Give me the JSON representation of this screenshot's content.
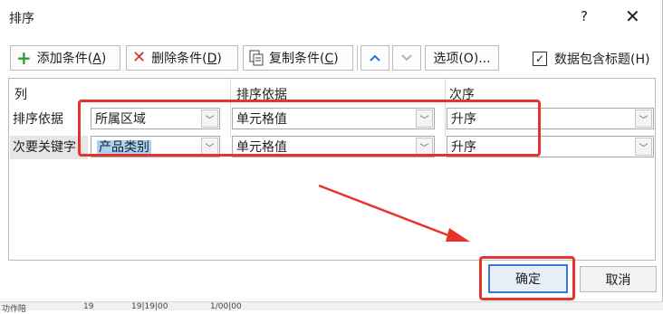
{
  "dialog": {
    "title": "排序",
    "help": "?",
    "close": "✕"
  },
  "toolbar": {
    "add": {
      "text": "添加条件(",
      "key": "A",
      "end": ")"
    },
    "delete": {
      "text": "删除条件(",
      "key": "D",
      "end": ")"
    },
    "copy": {
      "text": "复制条件(",
      "key": "C",
      "end": ")"
    },
    "options": "选项(O)...",
    "header_checkbox": {
      "label": "数据包含标题(H)",
      "checked": true
    }
  },
  "columns": {
    "col": "列",
    "sort_on": "排序依据",
    "order": "次序"
  },
  "rows": [
    {
      "label": "排序依据",
      "column": "所属区域",
      "sort_on": "单元格值",
      "order": "升序"
    },
    {
      "label": "次要关键字",
      "column": "产品类别",
      "sort_on": "单元格值",
      "order": "升序"
    }
  ],
  "buttons": {
    "ok": "确定",
    "cancel": "取消"
  },
  "background_fragments": [
    "功作陪",
    "19",
    "19|19|00",
    "1/00|00"
  ]
}
